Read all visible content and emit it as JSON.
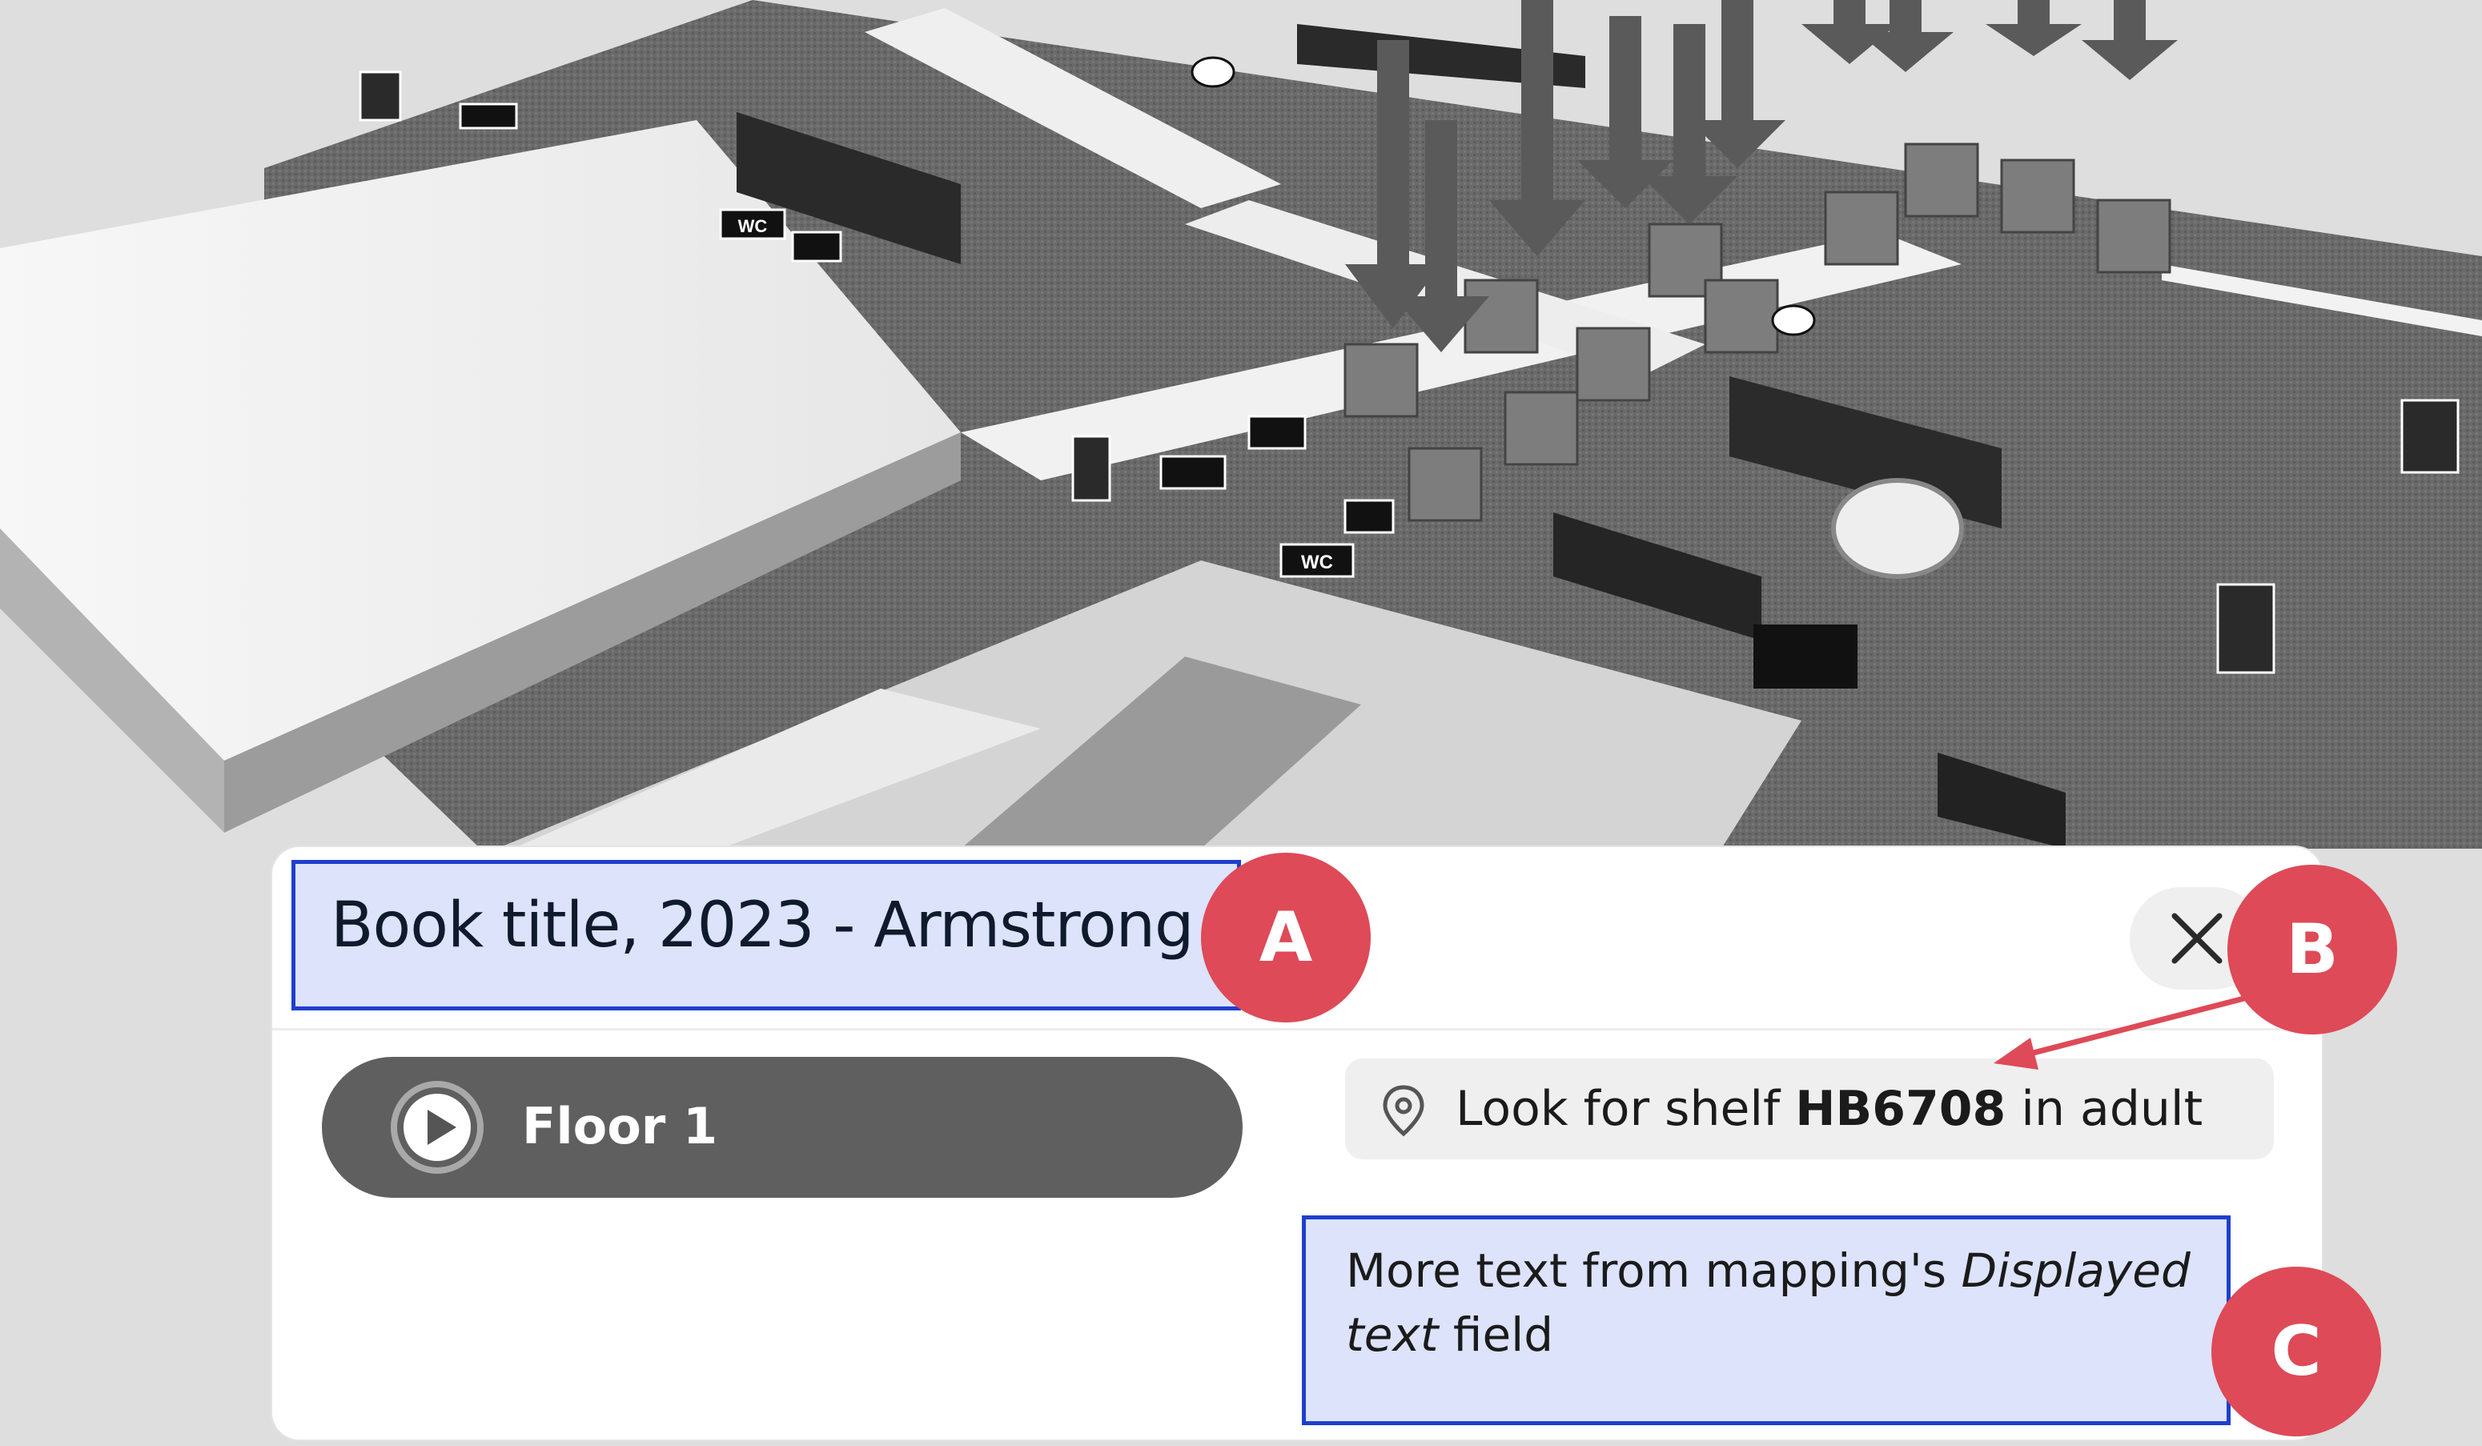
{
  "map": {
    "description_icons": [
      "exit-sign-icon",
      "elevator-icon",
      "wc-icon",
      "accessible-wc-icon",
      "info-icon",
      "baby-change-icon"
    ],
    "signs": {
      "wc_label": "WC"
    }
  },
  "panel": {
    "title": "Book title, 2023 - Armstrong",
    "close_label": "×",
    "floor_button": {
      "label": "Floor 1"
    },
    "shelf": {
      "prefix": "Look for shelf ",
      "code": "HB6708",
      "suffix": " in adult"
    },
    "more_text": {
      "part1": "More text from mapping's ",
      "italic1": "Displayed",
      "italic2": "text",
      "part2": " field"
    }
  },
  "annotations": {
    "a": "A",
    "b": "B",
    "c": "C",
    "color": "#de4a57",
    "box_color": "#1f3fcf"
  }
}
